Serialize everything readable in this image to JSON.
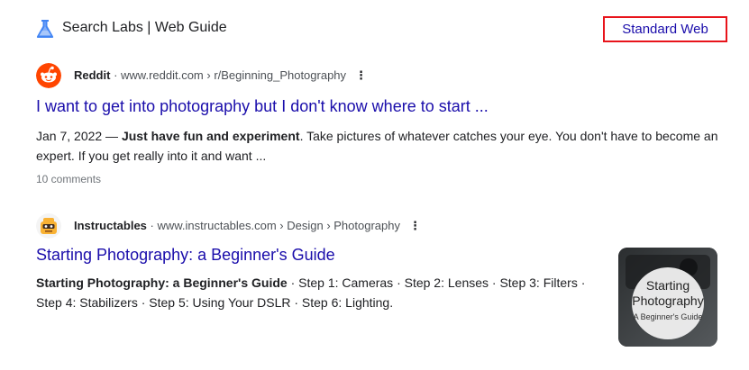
{
  "header": {
    "title": "Search Labs | Web Guide",
    "standard_web_label": "Standard Web",
    "labs_icon": "flask-icon"
  },
  "results": [
    {
      "source_name": "Reddit",
      "source_url": "www.reddit.com › r/Beginning_Photography",
      "favicon": "reddit-icon",
      "title": "I want to get into photography but I don't know where to start ...",
      "snippet_date": "Jan 7, 2022",
      "snippet_sep": " — ",
      "snippet_bold": "Just have fun and experiment",
      "snippet_rest": ". Take pictures of whatever catches your eye. You don't have to become an expert. If you get really into it and want ...",
      "comments": "10 comments"
    },
    {
      "source_name": "Instructables",
      "source_url": "www.instructables.com › Design › Photography",
      "favicon": "instructables-icon",
      "title": "Starting Photography: a Beginner's Guide",
      "snippet_bold": "Starting Photography: a Beginner's Guide",
      "snippet_rest": " · Step 1: Cameras · Step 2: Lenses · Step 3: Filters · Step 4: Stabilizers · Step 5: Using Your DSLR · Step 6: Lighting.",
      "thumbnail": {
        "line1": "Starting",
        "line2": "Photography",
        "line3": "A Beginner's Guide"
      }
    }
  ],
  "source_separator": " · ",
  "kebab_glyph": "⋮",
  "colors": {
    "link": "#1a0dab",
    "highlight_box": "#e8141b",
    "reddit": "#ff4500",
    "labs_icon": "#4285f4"
  }
}
